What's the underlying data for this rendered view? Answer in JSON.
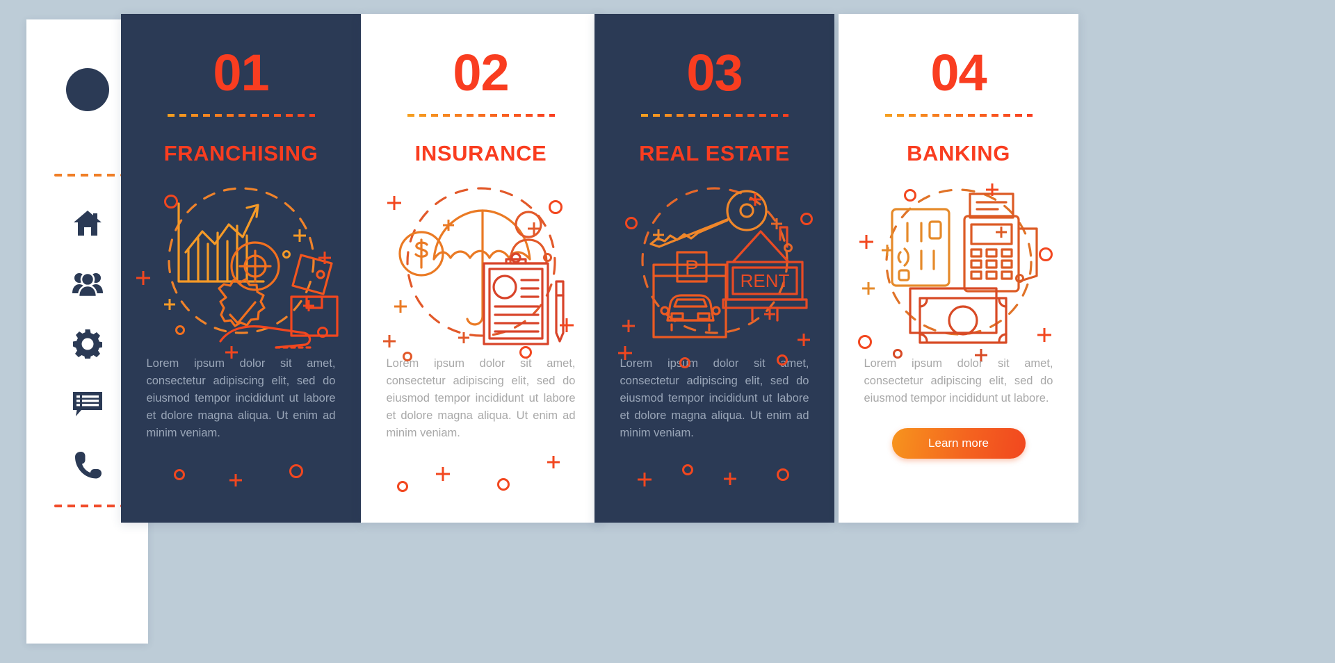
{
  "theme": {
    "page_background": "#bdccd7",
    "dark_card": "#2b3a55",
    "light_card": "#ffffff",
    "accent_red": "#f93d20",
    "accent_orange": "#f58220",
    "body_text_dark_card": "#9aa6b8",
    "body_text_light_card": "#a8a8a8",
    "button_gradient_from": "#f7941e",
    "button_gradient_to": "#f1471f"
  },
  "sidebar": {
    "avatar_label": "avatar",
    "icons": [
      {
        "name": "home-icon",
        "label": "Home"
      },
      {
        "name": "people-icon",
        "label": "People"
      },
      {
        "name": "gear-icon",
        "label": "Settings"
      },
      {
        "name": "chat-list-icon",
        "label": "Messages"
      },
      {
        "name": "phone-icon",
        "label": "Contact"
      }
    ]
  },
  "cards": [
    {
      "number": "01",
      "title": "FRANCHISING",
      "body": "Lorem ipsum dolor sit amet, consectetur adipiscing elit, sed do eiusmod tempor incididunt ut labore et dolore magna aliqua. Ut enim ad minim veniam.",
      "theme": "dark",
      "illustration": "franchising-illustration",
      "illustration_elements": [
        "bar-chart",
        "growth-arrow",
        "target",
        "price-tag",
        "package-box",
        "quality-badge-check",
        "open-hand"
      ],
      "has_button": false
    },
    {
      "number": "02",
      "title": "INSURANCE",
      "body": "Lorem ipsum dolor sit amet, consectetur adipiscing elit, sed do eiusmod tempor incididunt ut labore et dolore magna aliqua. Ut enim ad minim veniam.",
      "theme": "light",
      "illustration": "insurance-illustration",
      "illustration_elements": [
        "umbrella",
        "dollar-coin",
        "person",
        "clipboard",
        "pen"
      ],
      "has_button": false
    },
    {
      "number": "03",
      "title": "REAL ESTATE",
      "body": "Lorem ipsum dolor sit amet, consectetur adipiscing elit, sed do eiusmod tempor incididunt ut labore et dolore magna aliqua. Ut enim ad minim veniam.",
      "theme": "dark",
      "illustration": "real-estate-illustration",
      "illustration_elements": [
        "key",
        "parking-sign",
        "car",
        "house",
        "rent-sign"
      ],
      "illustration_labels": {
        "parking": "P",
        "rent": "RENT"
      },
      "has_button": false
    },
    {
      "number": "04",
      "title": "BANKING",
      "body": "Lorem ipsum dolor sit amet, consectetur adipiscing elit, sed do eiusmod tempor incididunt ut labore.",
      "theme": "light",
      "illustration": "banking-illustration",
      "illustration_elements": [
        "credit-card",
        "contactless-symbol",
        "pos-terminal",
        "banknotes"
      ],
      "has_button": true,
      "button_label": "Learn more"
    }
  ]
}
